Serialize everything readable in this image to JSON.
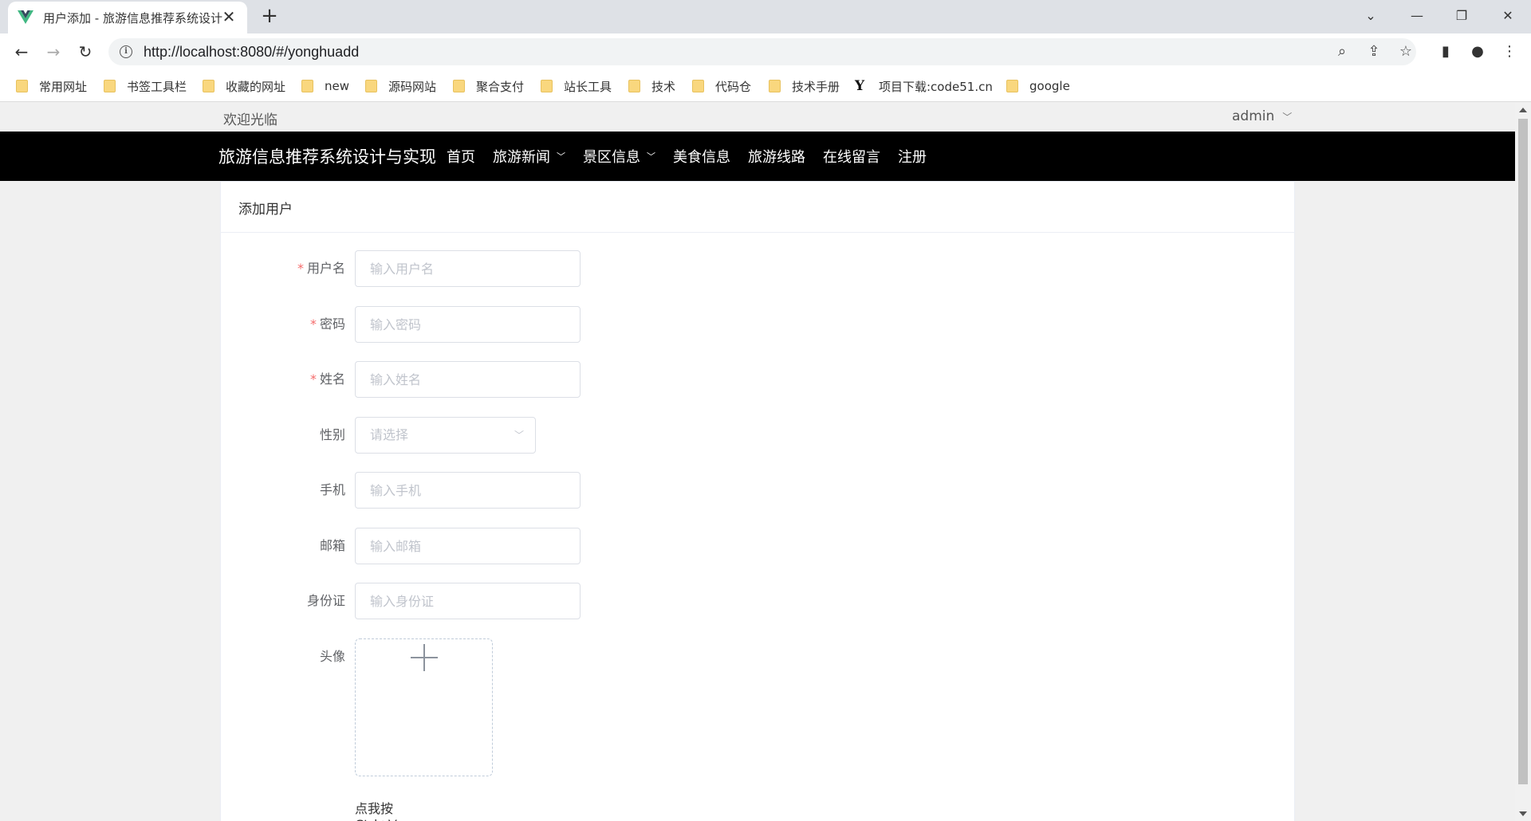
{
  "browser": {
    "tab_title": "用户添加 - 旅游信息推荐系统设计",
    "url": "http://localhost:8080/#/yonghuadd",
    "bookmarks": [
      {
        "label": "常用网址",
        "icon": "folder-icon"
      },
      {
        "label": "书签工具栏",
        "icon": "folder-icon"
      },
      {
        "label": "收藏的网址",
        "icon": "folder-icon"
      },
      {
        "label": "new",
        "icon": "folder-icon"
      },
      {
        "label": "源码网站",
        "icon": "folder-icon"
      },
      {
        "label": "聚合支付",
        "icon": "folder-icon"
      },
      {
        "label": "站长工具",
        "icon": "folder-icon"
      },
      {
        "label": "技术",
        "icon": "folder-icon"
      },
      {
        "label": "代码仓",
        "icon": "folder-icon"
      },
      {
        "label": "技术手册",
        "icon": "folder-icon"
      },
      {
        "label": "项目下载:code51.cn",
        "icon": "y-logo-icon"
      },
      {
        "label": "google",
        "icon": "folder-icon"
      }
    ]
  },
  "header": {
    "welcome": "欢迎光临",
    "user": "admin"
  },
  "nav": {
    "brand": "旅游信息推荐系统设计与实现",
    "items": [
      {
        "label": "首页",
        "has_dropdown": false
      },
      {
        "label": "旅游新闻",
        "has_dropdown": true
      },
      {
        "label": "景区信息",
        "has_dropdown": true
      },
      {
        "label": "美食信息",
        "has_dropdown": false
      },
      {
        "label": "旅游线路",
        "has_dropdown": false
      },
      {
        "label": "在线留言",
        "has_dropdown": false
      },
      {
        "label": "注册",
        "has_dropdown": false
      }
    ]
  },
  "form": {
    "title": "添加用户",
    "fields": {
      "username": {
        "label": "用户名",
        "required": true,
        "placeholder": "输入用户名",
        "value": ""
      },
      "password": {
        "label": "密码",
        "required": true,
        "placeholder": "输入密码",
        "value": ""
      },
      "name": {
        "label": "姓名",
        "required": true,
        "placeholder": "输入姓名",
        "value": ""
      },
      "gender": {
        "label": "性别",
        "required": false,
        "placeholder": "请选择"
      },
      "phone": {
        "label": "手机",
        "required": false,
        "placeholder": "输入手机",
        "value": ""
      },
      "email": {
        "label": "邮箱",
        "required": false,
        "placeholder": "输入邮箱",
        "value": ""
      },
      "idcard": {
        "label": "身份证",
        "required": false,
        "placeholder": "输入身份证",
        "value": ""
      },
      "avatar": {
        "label": "头像",
        "paste_hint": "点我按Ctrl+V粘贴"
      }
    },
    "required_mark": "*"
  },
  "colors": {
    "navbar_bg": "#000000",
    "required": "#f56c6c",
    "placeholder": "#c0c4cc"
  }
}
